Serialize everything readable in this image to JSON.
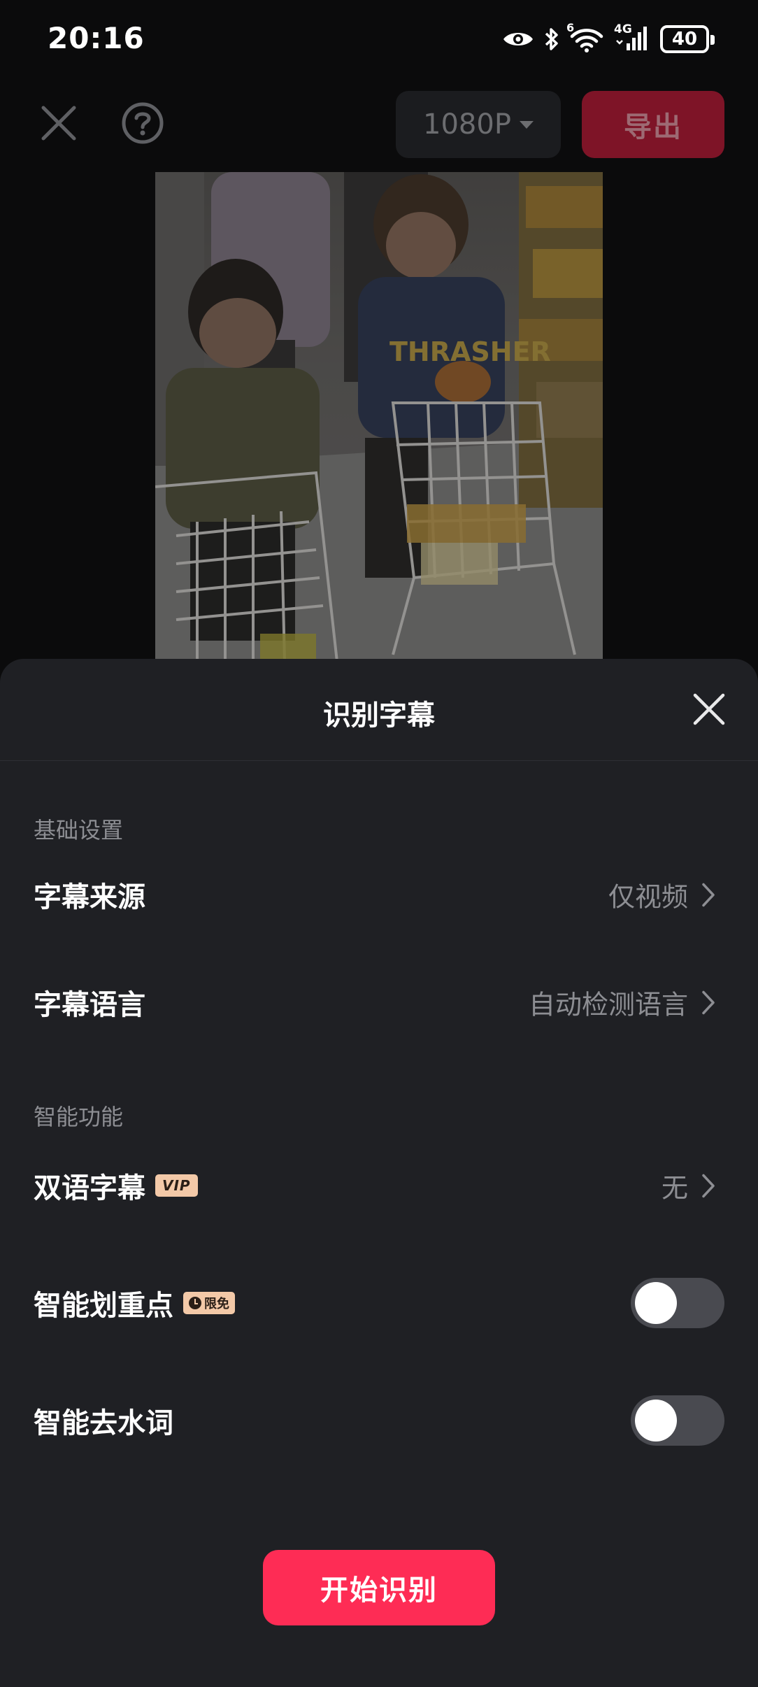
{
  "status_bar": {
    "time": "20:16",
    "network_label": "4G",
    "wifi_label": "6",
    "battery": "40"
  },
  "toolbar": {
    "resolution_label": "1080P",
    "export_label": "导出"
  },
  "sheet": {
    "title": "识别字幕",
    "sections": {
      "basic": "基础设置",
      "smart": "智能功能"
    },
    "rows": {
      "subtitle_source": {
        "label": "字幕来源",
        "value": "仅视频"
      },
      "subtitle_language": {
        "label": "字幕语言",
        "value": "自动检测语言"
      },
      "bilingual": {
        "label": "双语字幕",
        "badge": "VIP",
        "value": "无"
      },
      "smart_highlight": {
        "label": "智能划重点",
        "badge": "限免",
        "enabled": false
      },
      "remove_fillers": {
        "label": "智能去水词",
        "enabled": false
      }
    },
    "start_button": "开始识别"
  },
  "colors": {
    "accent": "#fe2c55",
    "sheet_bg": "#1f2024",
    "badge_bg": "#f3c9a8"
  }
}
